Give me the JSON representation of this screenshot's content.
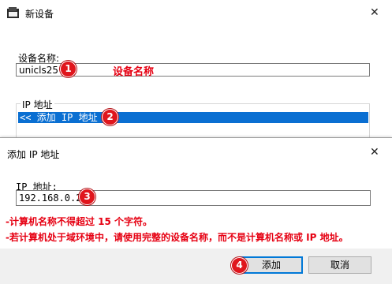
{
  "main_dialog": {
    "title": "新设备",
    "close_glyph": "✕",
    "device_name_label": "设备名称:",
    "device_name_value": "unicls25",
    "device_name_annotation": "设备名称",
    "ip_group_label": "IP 地址",
    "ip_list_item": "<< 添加 IP 地址 >>"
  },
  "add_ip_dialog": {
    "title": "添加 IP 地址",
    "close_glyph": "✕",
    "ip_label": "IP 地址:",
    "ip_value": "192.168.0.2",
    "note_1": "-计算机名称不得超过 15 个字符。",
    "note_2": "-若计算机处于域环境中，请使用完整的设备名称，而不是计算机名称或 IP 地址。",
    "add_button": "添加",
    "cancel_button": "取消"
  },
  "step_badges": [
    "1",
    "2",
    "3",
    "4"
  ],
  "colors": {
    "annotation_red": "#e60012",
    "badge_red": "#e0161d",
    "selection_blue": "#0a6fd2",
    "default_button_border": "#0078d7",
    "footer_bg": "#f0f0f0"
  }
}
